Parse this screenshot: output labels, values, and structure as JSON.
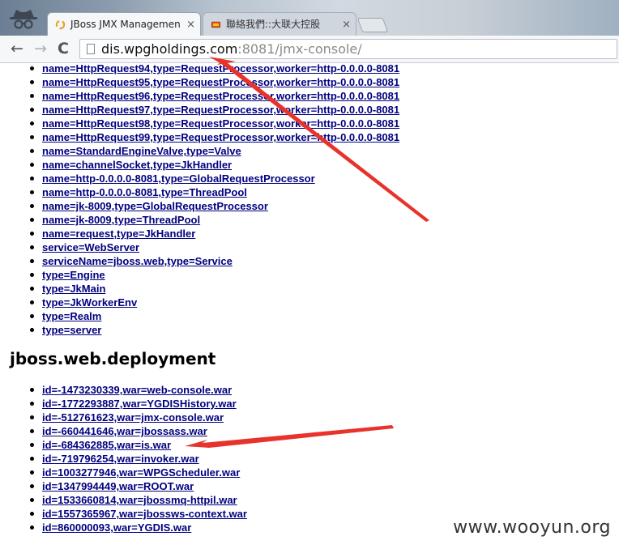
{
  "browser": {
    "tabs": [
      {
        "title": "JBoss JMX Managemen",
        "active": true
      },
      {
        "title": "聯絡我們::大联大控股",
        "active": false
      }
    ],
    "url": {
      "host": "dis.wpgholdings.com",
      "rest": ":8081/jmx-console/"
    },
    "icons": {
      "back": "←",
      "forward": "→",
      "reload": "C",
      "close": "×",
      "incognito": "incognito-icon",
      "page": "page-icon"
    }
  },
  "mbeans": [
    "name=HttpRequest94,type=RequestProcessor,worker=http-0.0.0.0-8081",
    "name=HttpRequest95,type=RequestProcessor,worker=http-0.0.0.0-8081",
    "name=HttpRequest96,type=RequestProcessor,worker=http-0.0.0.0-8081",
    "name=HttpRequest97,type=RequestProcessor,worker=http-0.0.0.0-8081",
    "name=HttpRequest98,type=RequestProcessor,worker=http-0.0.0.0-8081",
    "name=HttpRequest99,type=RequestProcessor,worker=http-0.0.0.0-8081",
    "name=StandardEngineValve,type=Valve",
    "name=channelSocket,type=JkHandler",
    "name=http-0.0.0.0-8081,type=GlobalRequestProcessor",
    "name=http-0.0.0.0-8081,type=ThreadPool",
    "name=jk-8009,type=GlobalRequestProcessor",
    "name=jk-8009,type=ThreadPool",
    "name=request,type=JkHandler",
    "service=WebServer",
    "serviceName=jboss.web,type=Service",
    "type=Engine",
    "type=JkMain",
    "type=JkWorkerEnv",
    "type=Realm",
    "type=server"
  ],
  "domain": {
    "title": "jboss.web.deployment",
    "items": [
      "id=-1473230339,war=web-console.war",
      "id=-1772293887,war=YGDISHistory.war",
      "id=-512761623,war=jmx-console.war",
      "id=-660441646,war=jbossass.war",
      "id=-684362885,war=is.war",
      "id=-719796254,war=invoker.war",
      "id=1003277946,war=WPGScheduler.war",
      "id=1347994449,war=ROOT.war",
      "id=1533660814,war=jbossmq-httpil.war",
      "id=1557365967,war=jbossws-context.war",
      "id=860000093,war=YGDIS.war"
    ]
  },
  "watermark": "www.wooyun.org",
  "colors": {
    "link": "#00007f",
    "arrow": "#e8322c"
  }
}
